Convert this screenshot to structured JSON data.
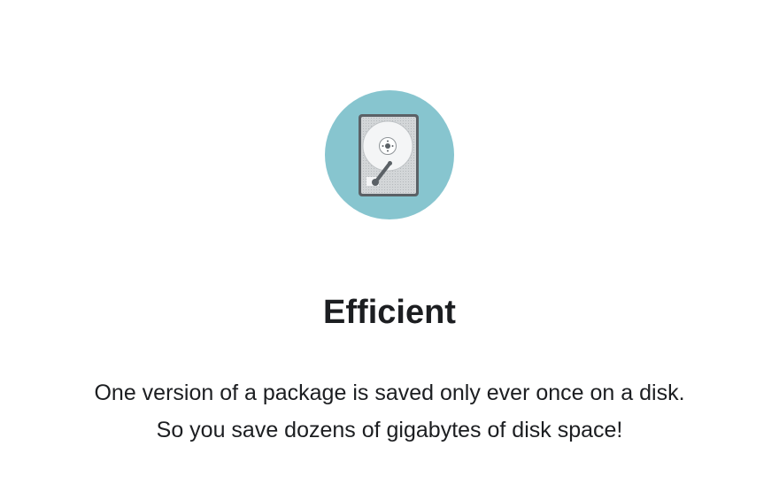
{
  "feature": {
    "icon": "hard-disk-icon",
    "icon_bg_color": "#87c5cf",
    "title": "Efficient",
    "description_lines": [
      "One version of a package is saved only ever once on a disk.",
      "So you save dozens of gigabytes of disk space!"
    ]
  }
}
